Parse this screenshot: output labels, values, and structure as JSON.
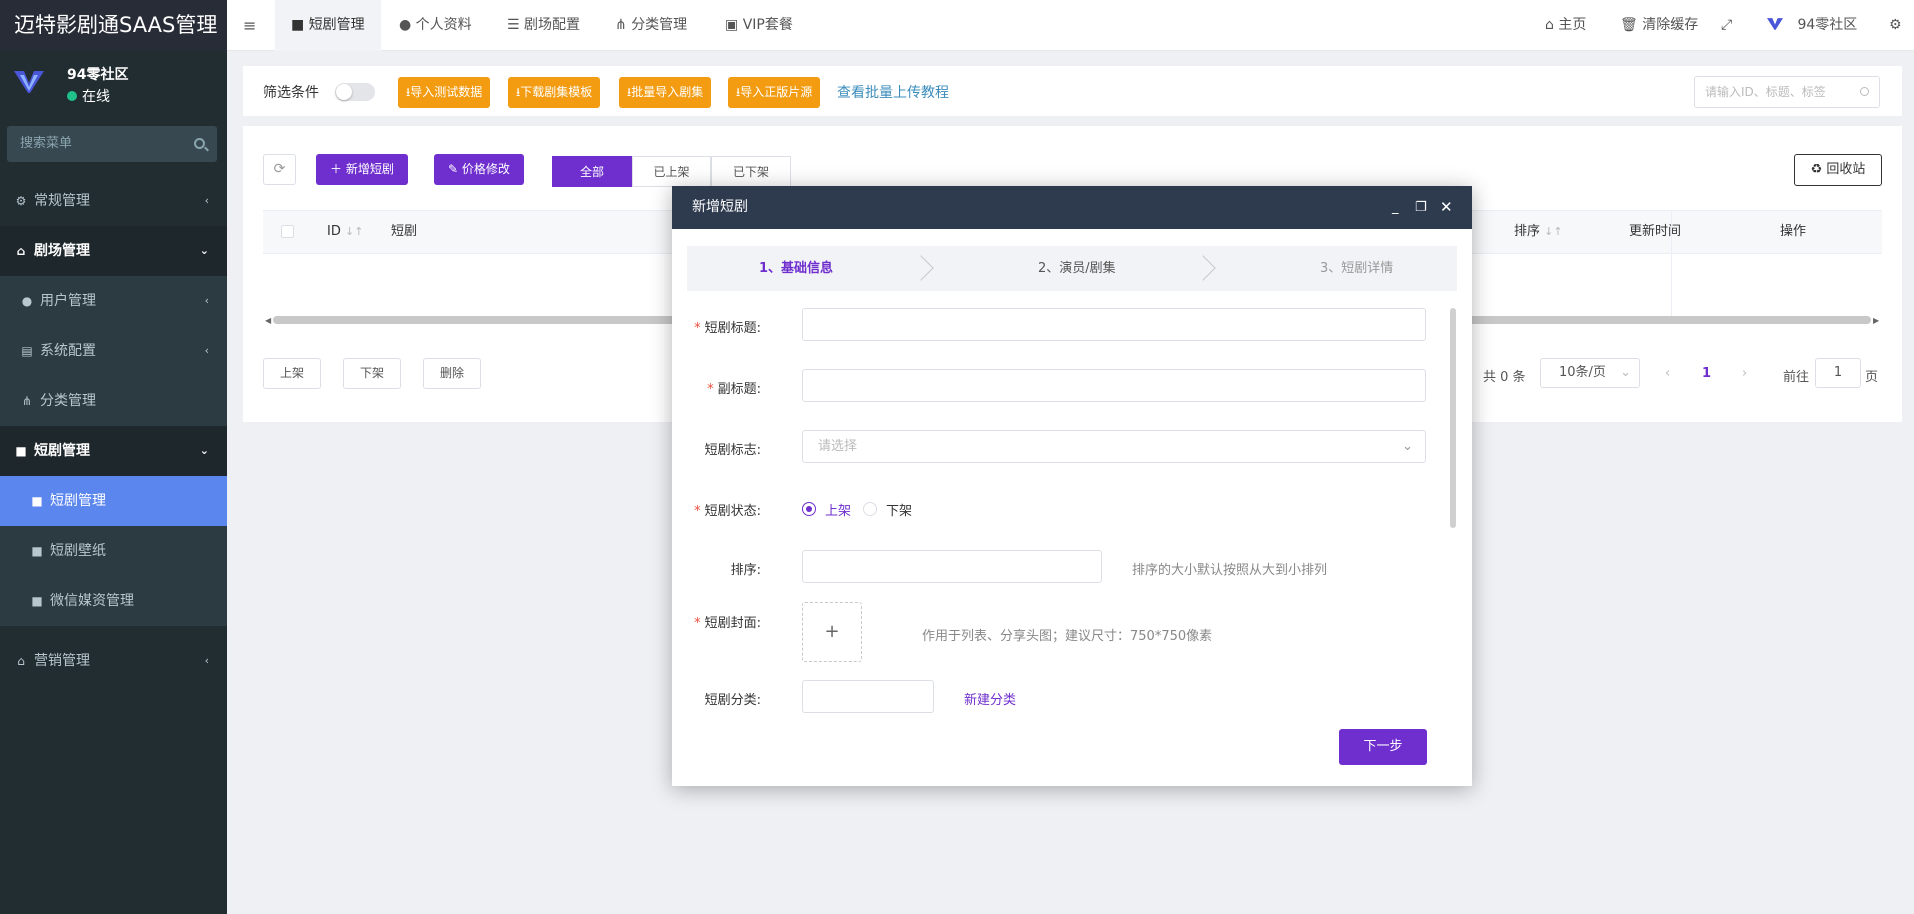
{
  "sidebar": {
    "brand": "迈特影剧通SAAS管理",
    "user": {
      "name": "94零社区",
      "status": "在线"
    },
    "search_placeholder": "搜索菜单",
    "items": [
      {
        "label": "常规管理",
        "icon": "gears-icon"
      },
      {
        "label": "剧场管理",
        "icon": "home-icon"
      },
      {
        "label": "用户管理",
        "icon": "user-icon"
      },
      {
        "label": "系统配置",
        "icon": "file-icon"
      },
      {
        "label": "分类管理",
        "icon": "sitemap-icon"
      },
      {
        "label": "短剧管理",
        "icon": "bag-icon"
      },
      {
        "label": "短剧管理",
        "icon": "bag-icon"
      },
      {
        "label": "短剧壁纸",
        "icon": "bag-icon"
      },
      {
        "label": "微信媒资管理",
        "icon": "bag-icon"
      },
      {
        "label": "营销管理",
        "icon": "home-icon"
      }
    ]
  },
  "topbar": {
    "tabs": [
      "短剧管理",
      "个人资料",
      "剧场配置",
      "分类管理",
      "VIP套餐"
    ],
    "right": {
      "home": "主页",
      "clear_cache": "清除缓存",
      "account": "94零社区"
    }
  },
  "filter": {
    "label": "筛选条件",
    "buttons": [
      "导入测试数据",
      "下载剧集模板",
      "批量导入剧集",
      "导入正版片源"
    ],
    "tutorial_link": "查看批量上传教程",
    "search_placeholder": "请输入ID、标题、标签"
  },
  "toolbar": {
    "add_label": "新增短剧",
    "price_label": "价格修改",
    "segments": [
      "全部",
      "已上架",
      "已下架"
    ],
    "recycle_label": "回收站"
  },
  "table": {
    "headers": {
      "id": "ID",
      "title": "短剧",
      "sort": "排序",
      "updated": "更新时间",
      "ops": "操作"
    }
  },
  "bulk": {
    "up": "上架",
    "down": "下架",
    "delete": "删除"
  },
  "pagination": {
    "total": "共 0 条",
    "page_size": "10条/页",
    "current": "1",
    "goto": "前往",
    "goto_value": "1",
    "page_suffix": "页"
  },
  "modal": {
    "title": "新增短剧",
    "steps": [
      "1、基础信息",
      "2、演员/剧集",
      "3、短剧详情"
    ],
    "fields": {
      "title": "短剧标题:",
      "subtitle": "副标题:",
      "tag": "短剧标志:",
      "tag_placeholder": "请选择",
      "status": "短剧状态:",
      "status_on": "上架",
      "status_off": "下架",
      "sort": "排序:",
      "sort_hint": "排序的大小默认按照从大到小排列",
      "cover": "短剧封面:",
      "cover_hint": "作用于列表、分享头图；建议尺寸：750*750像素",
      "category": "短剧分类:",
      "new_category": "新建分类"
    },
    "next_label": "下一步"
  },
  "colors": {
    "accent": "#6f2fce",
    "orange": "#f39c12",
    "sidebar": "#222d32",
    "active_menu": "#5b86ee"
  }
}
